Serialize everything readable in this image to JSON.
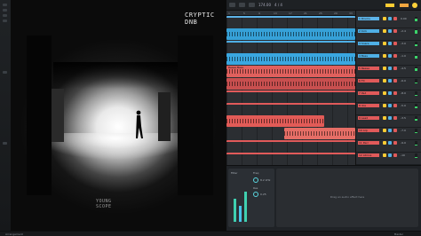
{
  "artwork": {
    "title": "CRYPTIC DNB",
    "logo_line1": "YOUNG",
    "logo_line2": "SCOPE"
  },
  "toolbar": {
    "tempo": "174.00",
    "signature": "4 / 4"
  },
  "ruler": {
    "ticks": [
      "1",
      "5",
      "9",
      "13",
      "17",
      "21",
      "25",
      "29",
      "33"
    ]
  },
  "tracks": [
    {
      "name": "1 Drums",
      "color": "#5db3e8",
      "volume": "0.00",
      "meter": 0.6,
      "clips": [
        {
          "start": 0,
          "end": 145,
          "color": "#2b2e32",
          "outline": true
        }
      ]
    },
    {
      "name": "2 Kick",
      "color": "#4fb0e6",
      "volume": "-2.4",
      "meter": 0.8,
      "clips": [
        {
          "start": 0,
          "end": 145,
          "color": "#36a1d8",
          "label": ""
        }
      ]
    },
    {
      "name": "3 Snare",
      "color": "#4fb0e6",
      "volume": "-3.0",
      "meter": 0.5,
      "clips": [
        {
          "start": 0,
          "end": 145,
          "color": "#2b2e32",
          "outline": true
        }
      ]
    },
    {
      "name": "4 Bass",
      "color": "#4fb0e6",
      "volume": "-1.0",
      "meter": 0.7,
      "clips": [
        {
          "start": 0,
          "end": 145,
          "color": "#3aa7e0",
          "label": ""
        }
      ]
    },
    {
      "name": "5 Reese",
      "color": "#e15a5a",
      "volume": "-4.5",
      "meter": 0.65,
      "clips": [
        {
          "start": 0,
          "end": 145,
          "color": "#e0605d",
          "label": "Reese Bass"
        }
      ]
    },
    {
      "name": "6 FX",
      "color": "#e15a5a",
      "volume": "-6.0",
      "meter": 0.3,
      "clips": [
        {
          "start": 0,
          "end": 145,
          "color": "#c84f4f",
          "label": ""
        }
      ]
    },
    {
      "name": "7 Pad",
      "color": "#e15a5a",
      "volume": "-8.0",
      "meter": 0.2,
      "clips": [
        {
          "start": 0,
          "end": 145,
          "color": "#2b2e32",
          "outline": true
        }
      ]
    },
    {
      "name": "8 Vox",
      "color": "#e15a5a",
      "volume": "-5.0",
      "meter": 0.4,
      "clips": [
        {
          "start": 0,
          "end": 145,
          "color": "#2b2e32",
          "outline": true
        }
      ]
    },
    {
      "name": "9 Lead",
      "color": "#e15a5a",
      "volume": "-3.5",
      "meter": 0.45,
      "clips": [
        {
          "start": 0,
          "end": 110,
          "color": "#e25b57",
          "label": ""
        }
      ]
    },
    {
      "name": "10 Arp",
      "color": "#e15a5a",
      "volume": "-7.0",
      "meter": 0.3,
      "clips": [
        {
          "start": 65,
          "end": 145,
          "color": "#e66e66",
          "label": ""
        }
      ]
    },
    {
      "name": "11 Perc",
      "color": "#e15a5a",
      "volume": "-9.0",
      "meter": 0.25,
      "clips": [
        {
          "start": 0,
          "end": 145,
          "color": "#2b2e32",
          "outline": true
        }
      ]
    },
    {
      "name": "12 Atmos",
      "color": "#e15a5a",
      "volume": "-10",
      "meter": 0.2,
      "clips": [
        {
          "start": 0,
          "end": 145,
          "color": "#2b2e32",
          "outline": true
        }
      ]
    }
  ],
  "device": {
    "label1": "Filter",
    "label2": "Freq",
    "label3": "Res",
    "value1": "8.2 kHz",
    "value2": "0.25"
  },
  "dropzone": {
    "message": "Drag an audio effect here"
  },
  "status": {
    "left": "Arrangement",
    "right": "Master"
  }
}
